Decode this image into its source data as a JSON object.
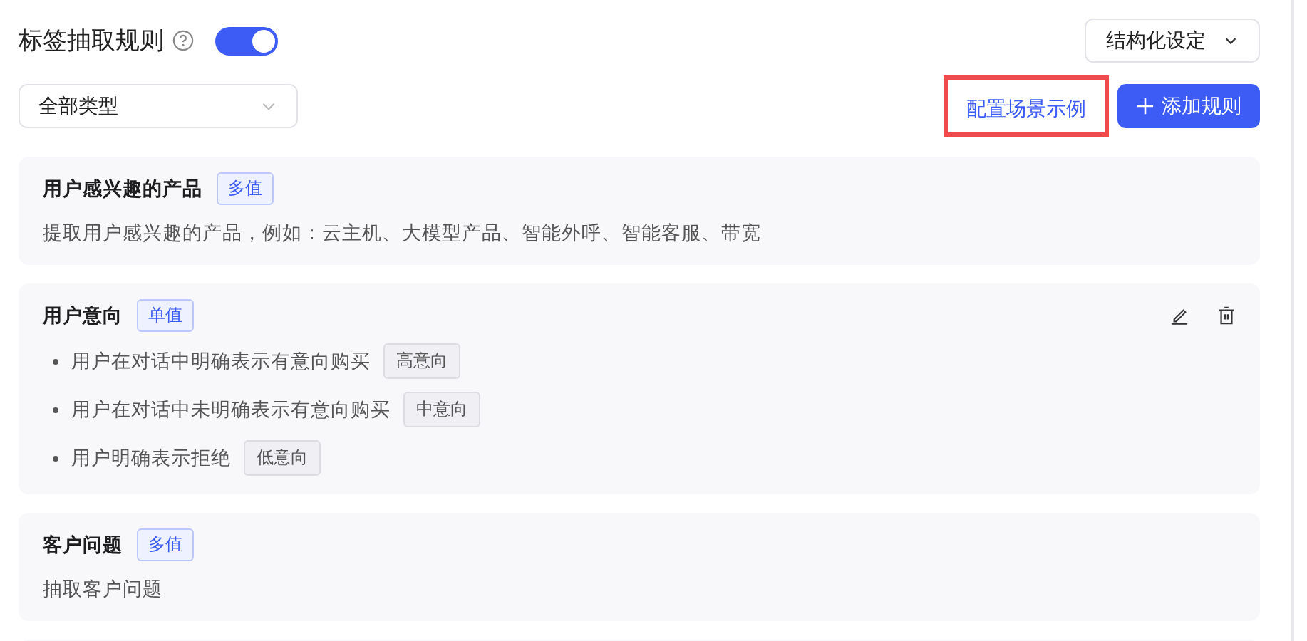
{
  "header": {
    "title": "标签抽取规则",
    "enabled": true,
    "mode_select": {
      "value": "结构化设定"
    }
  },
  "toolbar": {
    "type_filter": {
      "value": "全部类型"
    },
    "example_link": {
      "label": "配置场景示例",
      "highlighted": true
    },
    "add_button": {
      "label": "添加规则"
    }
  },
  "rules": [
    {
      "kind": "rule",
      "name": "用户感兴趣的产品",
      "tag": "多值",
      "description": "提取用户感兴趣的产品，例如：云主机、大模型产品、智能外呼、智能客服、带宽",
      "actions_visible": false
    },
    {
      "kind": "rule",
      "name": "用户意向",
      "tag": "单值",
      "actions_visible": true,
      "items": [
        {
          "text": "用户在对话中明确表示有意向购买",
          "level": "高意向"
        },
        {
          "text": "用户在对话中未明确表示有意向购买",
          "level": "中意向"
        },
        {
          "text": "用户明确表示拒绝",
          "level": "低意向"
        }
      ]
    },
    {
      "kind": "rule",
      "name": "客户问题",
      "tag": "多值",
      "description": "抽取客户问题",
      "actions_visible": false
    },
    {
      "kind": "empty"
    }
  ]
}
